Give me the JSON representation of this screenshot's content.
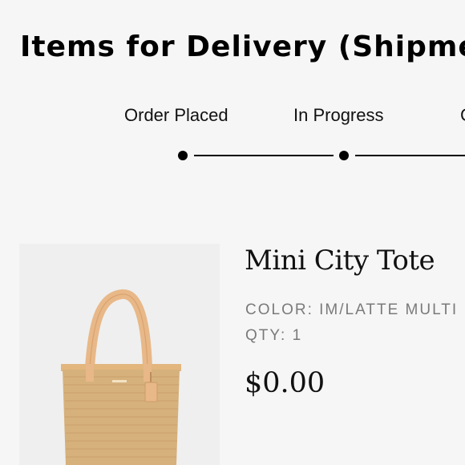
{
  "page": {
    "title": "Items for Delivery (Shipment"
  },
  "progress": {
    "steps": [
      {
        "label": "Order Placed"
      },
      {
        "label": "In Progress"
      },
      {
        "label": "C"
      }
    ]
  },
  "product": {
    "name": "Mini City Tote",
    "color_label": "COLOR:",
    "color_value": "IM/LATTE MULTI",
    "qty_label": "QTY:",
    "qty_value": "1",
    "price": "$0.00",
    "image_icon": "tote-bag-image",
    "colors": {
      "straw": "#d6b17c",
      "leather": "#e8b888"
    }
  }
}
